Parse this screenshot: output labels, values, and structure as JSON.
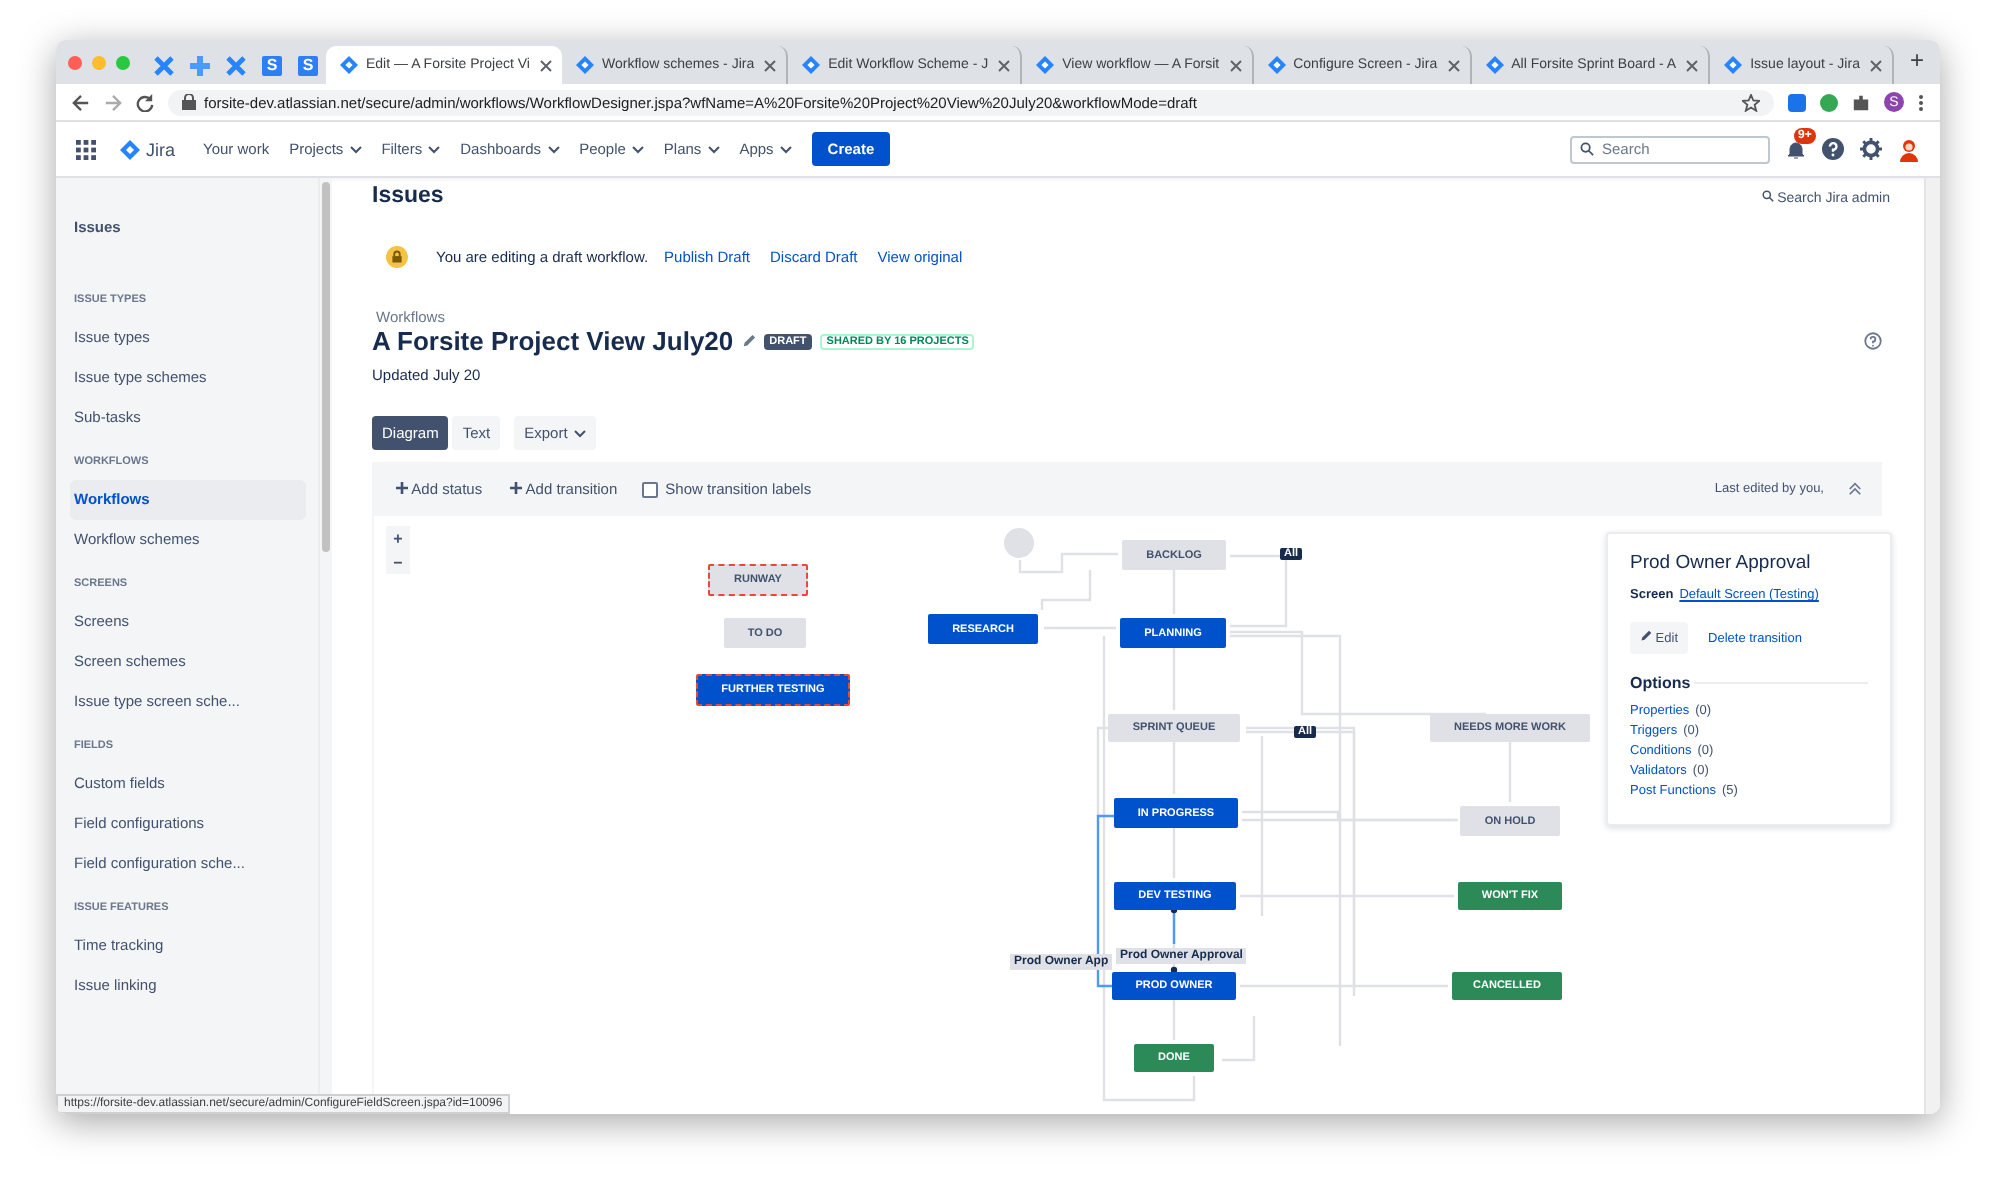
{
  "browser": {
    "pinned_tabs": [
      {
        "kind": "x"
      },
      {
        "kind": "plus"
      },
      {
        "kind": "x"
      },
      {
        "kind": "letter",
        "letter": "S"
      },
      {
        "kind": "letter",
        "letter": "S"
      }
    ],
    "tabs": [
      {
        "title": "Edit — A Forsite Project Vi",
        "selected": true
      },
      {
        "title": "Workflow schemes - Jira",
        "selected": false
      },
      {
        "title": "Edit Workflow Scheme - J",
        "selected": false
      },
      {
        "title": "View workflow — A Forsit",
        "selected": false
      },
      {
        "title": "Configure Screen - Jira",
        "selected": false
      },
      {
        "title": "All Forsite Sprint Board - A",
        "selected": false
      },
      {
        "title": "Issue layout - Jira",
        "selected": false
      }
    ],
    "new_tab": "+",
    "url": "forsite-dev.atlassian.net/secure/admin/workflows/WorkflowDesigner.jspa?wfName=A%20Forsite%20Project%20View%20July20&workflowMode=draft",
    "profile_letter": "S",
    "status_url": "https://forsite-dev.atlassian.net/secure/admin/ConfigureFieldScreen.jspa?id=10096"
  },
  "nav": {
    "product": "Jira",
    "items": [
      {
        "label": "Your work",
        "dropdown": false
      },
      {
        "label": "Projects",
        "dropdown": true
      },
      {
        "label": "Filters",
        "dropdown": true
      },
      {
        "label": "Dashboards",
        "dropdown": true
      },
      {
        "label": "People",
        "dropdown": true
      },
      {
        "label": "Plans",
        "dropdown": true
      },
      {
        "label": "Apps",
        "dropdown": true
      }
    ],
    "create": "Create",
    "search_placeholder": "Search",
    "notifications": "9+"
  },
  "sidebar": {
    "top": "Issues",
    "sections": [
      {
        "heading": "ISSUE TYPES",
        "items": [
          {
            "label": "Issue types",
            "selected": false
          },
          {
            "label": "Issue type schemes",
            "selected": false
          },
          {
            "label": "Sub-tasks",
            "selected": false
          }
        ]
      },
      {
        "heading": "WORKFLOWS",
        "items": [
          {
            "label": "Workflows",
            "selected": true
          },
          {
            "label": "Workflow schemes",
            "selected": false
          }
        ]
      },
      {
        "heading": "SCREENS",
        "items": [
          {
            "label": "Screens",
            "selected": false
          },
          {
            "label": "Screen schemes",
            "selected": false
          },
          {
            "label": "Issue type screen sche...",
            "selected": false
          }
        ]
      },
      {
        "heading": "FIELDS",
        "items": [
          {
            "label": "Custom fields",
            "selected": false
          },
          {
            "label": "Field configurations",
            "selected": false
          },
          {
            "label": "Field configuration sche...",
            "selected": false
          }
        ]
      },
      {
        "heading": "ISSUE FEATURES",
        "items": [
          {
            "label": "Time tracking",
            "selected": false
          },
          {
            "label": "Issue linking",
            "selected": false
          }
        ]
      }
    ]
  },
  "page": {
    "header": "Issues",
    "search_admin": "Search Jira admin",
    "banner": {
      "message": "You are editing a draft workflow.",
      "actions": [
        "Publish Draft",
        "Discard Draft",
        "View original"
      ]
    },
    "breadcrumb": "Workflows",
    "title": "A Forsite Project View July20",
    "draft_lozenge": "DRAFT",
    "shared_lozenge": "SHARED BY 16 PROJECTS",
    "updated": "Updated July 20",
    "view_tabs": [
      {
        "label": "Diagram",
        "selected": true
      },
      {
        "label": "Text",
        "selected": false
      },
      {
        "label": "Export",
        "selected": false
      }
    ],
    "toolbar": {
      "add_status": "Add status",
      "add_transition": "Add transition",
      "show_labels": {
        "label": "Show transition labels",
        "checked": false
      },
      "last_edited": "Last edited by you,"
    }
  },
  "diagram": {
    "zoom": [
      "+",
      "−"
    ],
    "statuses": [
      {
        "name": "RUNWAY",
        "kind": "todo",
        "flagged": true
      },
      {
        "name": "TO DO",
        "kind": "todo",
        "flagged": false
      },
      {
        "name": "FURTHER TESTING",
        "kind": "inprogress",
        "flagged": true
      },
      {
        "name": "RESEARCH",
        "kind": "inprogress",
        "flagged": false
      },
      {
        "name": "BACKLOG",
        "kind": "todo",
        "flagged": false
      },
      {
        "name": "PLANNING",
        "kind": "inprogress",
        "flagged": false
      },
      {
        "name": "SPRINT QUEUE",
        "kind": "todo",
        "flagged": false
      },
      {
        "name": "IN PROGRESS",
        "kind": "inprogress",
        "flagged": false
      },
      {
        "name": "DEV TESTING",
        "kind": "inprogress",
        "flagged": false
      },
      {
        "name": "PROD OWNER",
        "kind": "inprogress",
        "flagged": false
      },
      {
        "name": "DONE",
        "kind": "done",
        "flagged": false
      },
      {
        "name": "NEEDS MORE WORK",
        "kind": "todo",
        "flagged": false
      },
      {
        "name": "ON HOLD",
        "kind": "todo",
        "flagged": false
      },
      {
        "name": "WON'T FIX",
        "kind": "done",
        "flagged": false
      },
      {
        "name": "CANCELLED",
        "kind": "done",
        "flagged": false
      }
    ],
    "all_labels": [
      "All",
      "All"
    ],
    "transition_labels": [
      "Prod Owner App",
      "Prod Owner Approval"
    ]
  },
  "panel": {
    "title": "Prod Owner Approval",
    "screen_label": "Screen",
    "screen_link": "Default Screen (Testing)",
    "edit": "Edit",
    "delete": "Delete transition",
    "options_heading": "Options",
    "options": [
      {
        "label": "Properties",
        "count": "(0)"
      },
      {
        "label": "Triggers",
        "count": "(0)"
      },
      {
        "label": "Conditions",
        "count": "(0)"
      },
      {
        "label": "Validators",
        "count": "(0)"
      },
      {
        "label": "Post Functions",
        "count": "(5)"
      }
    ]
  }
}
